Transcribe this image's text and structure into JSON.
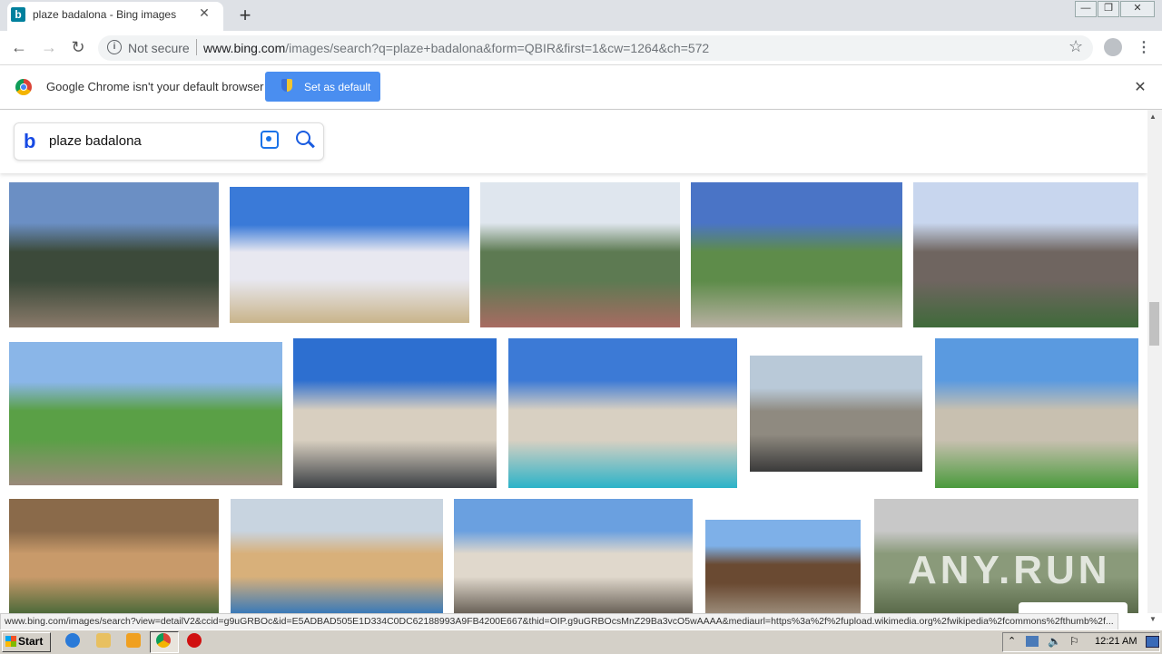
{
  "browser": {
    "tab": {
      "favicon": "b",
      "title": "plaze badalona - Bing images",
      "close": "✕"
    },
    "new_tab": "+",
    "window_buttons": {
      "minimize": "—",
      "restore": "❐",
      "close": "✕"
    },
    "nav": {
      "back": "←",
      "forward": "→",
      "reload": "↻"
    },
    "address": {
      "security_label": "Not secure",
      "url_host": "www.bing.com",
      "url_path": "/images/search?q=plaze+badalona&form=QBIR&first=1&cw=1264&ch=572"
    },
    "star": "☆",
    "menu": "⋮"
  },
  "infobar": {
    "message": "Google Chrome isn't your default browser",
    "button_label": "Set as default",
    "close": "✕"
  },
  "search": {
    "logo": "b",
    "query": "plaze badalona"
  },
  "images": [
    {
      "colors": [
        "#6b8fc4",
        "#3c4a3a",
        "#8a7a6a"
      ]
    },
    {
      "colors": [
        "#3a7ad8",
        "#e8e8f0",
        "#c9b48a"
      ]
    },
    {
      "colors": [
        "#dfe6ee",
        "#5d7a52",
        "#a86b62"
      ]
    },
    {
      "colors": [
        "#4a74c6",
        "#5e8c4a",
        "#b8b0a2"
      ]
    },
    {
      "colors": [
        "#c8d6ee",
        "#6f6560",
        "#3f6a3a"
      ]
    },
    {
      "colors": [
        "#8ab6e8",
        "#5aa046",
        "#9a8a7a"
      ]
    },
    {
      "colors": [
        "#2d6fd0",
        "#d8cfc0",
        "#3b3f44"
      ]
    },
    {
      "colors": [
        "#3c7ad6",
        "#d8d0c2",
        "#2bb3c8"
      ]
    },
    {
      "colors": [
        "#b9c9d8",
        "#8f8a80",
        "#3a3a3a"
      ]
    },
    {
      "colors": [
        "#5a9ae0",
        "#c8c0b0",
        "#4a9a3c"
      ]
    },
    {
      "colors": [
        "#8a6a4a",
        "#c89a6a",
        "#4d6a3a"
      ]
    },
    {
      "colors": [
        "#c8d4e0",
        "#d8b07a",
        "#3a7ab8"
      ]
    },
    {
      "colors": [
        "#6aa0e0",
        "#e0d8cc",
        "#6a6258"
      ]
    },
    {
      "colors": [
        "#7eb0e8",
        "#6a4a32",
        "#9a8a78"
      ]
    },
    {
      "colors": [
        "#c8c8c8",
        "#8a9a7a",
        "#5a6a4a"
      ]
    }
  ],
  "status_url": "www.bing.com/images/search?view=detailV2&ccid=g9uGRBOc&id=E5ADBAD505E1D334C0DC62188993A9FB4200E667&thid=OIP.g9uGRBOcsMnZ29Ba3vcO5wAAAA&mediaurl=https%3a%2f%2fupload.wikimedia.org%2fwikipedia%2fcommons%2fthumb%2f...",
  "watermark": "ANY.RUN",
  "taskbar": {
    "start_label": "Start",
    "clock": "12:21 AM"
  }
}
